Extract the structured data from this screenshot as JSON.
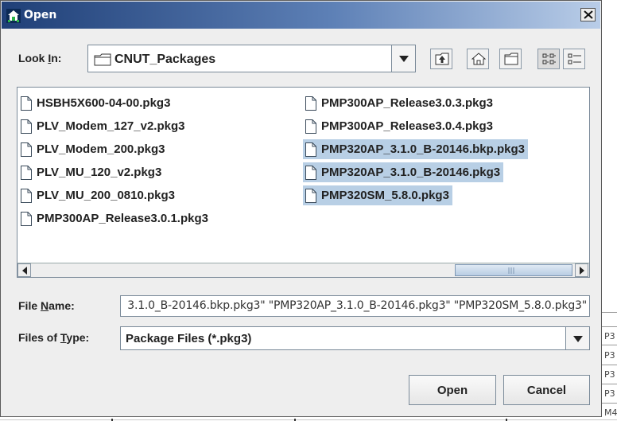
{
  "dialog": {
    "title": "Open",
    "look_in_label_pre": "Look ",
    "look_in_label_mnemonic": "I",
    "look_in_label_post": "n:",
    "look_in_value": "CNUT_Packages",
    "file_name_label_pre": "File ",
    "file_name_label_mnemonic": "N",
    "file_name_label_post": "ame:",
    "file_name_value": "3.1.0_B-20146.bkp.pkg3\" \"PMP320AP_3.1.0_B-20146.pkg3\" \"PMP320SM_5.8.0.pkg3\"",
    "files_of_type_label_pre": "Files of ",
    "files_of_type_label_mnemonic": "T",
    "files_of_type_label_post": "ype:",
    "files_of_type_value": "Package Files (*.pkg3)",
    "open_button": "Open",
    "cancel_button": "Cancel"
  },
  "toolbar_icons": [
    "up-one-level-icon",
    "home-icon",
    "new-folder-icon",
    "list-view-icon",
    "details-view-icon"
  ],
  "files": [
    {
      "name": "HSBH5X600-04-00.pkg3",
      "selected": false
    },
    {
      "name": "PLV_Modem_127_v2.pkg3",
      "selected": false
    },
    {
      "name": "PLV_Modem_200.pkg3",
      "selected": false
    },
    {
      "name": "PLV_MU_120_v2.pkg3",
      "selected": false
    },
    {
      "name": "PLV_MU_200_0810.pkg3",
      "selected": false
    },
    {
      "name": "PMP300AP_Release3.0.1.pkg3",
      "selected": false
    },
    {
      "name": "PMP300AP_Release3.0.3.pkg3",
      "selected": false
    },
    {
      "name": "PMP300AP_Release3.0.4.pkg3",
      "selected": false
    },
    {
      "name": "PMP320AP_3.1.0_B-20146.bkp.pkg3",
      "selected": true
    },
    {
      "name": "PMP320AP_3.1.0_B-20146.pkg3",
      "selected": true
    },
    {
      "name": "PMP320SM_5.8.0.pkg3",
      "selected": true
    }
  ],
  "background_side_text": [
    "P3",
    "P3",
    "P3",
    "P3",
    "M4"
  ],
  "colors": {
    "selection": "#b8cfe5",
    "titlebar_start": "#1f3f77",
    "titlebar_end": "#b9cde8"
  }
}
